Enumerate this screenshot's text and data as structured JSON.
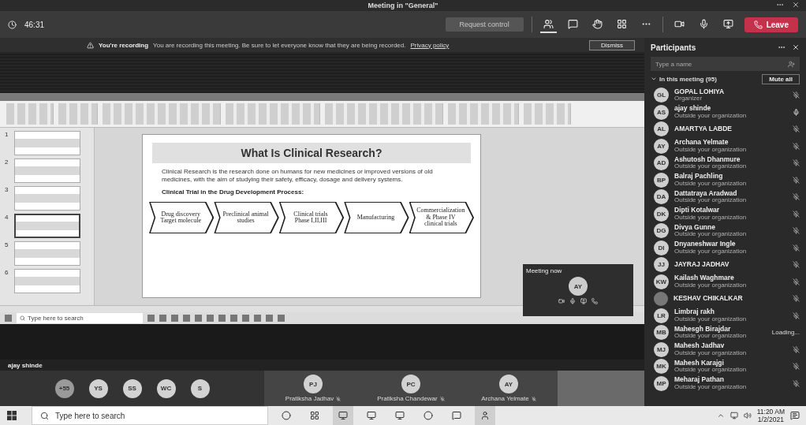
{
  "window": {
    "title": "Meeting in \"General\""
  },
  "toolbar": {
    "timer": "46:31",
    "request_control": {
      "label": "Request control",
      "disabled": true
    },
    "icons": [
      {
        "kind": "people",
        "selected": true
      },
      {
        "kind": "chat",
        "selected": false
      },
      {
        "kind": "hand",
        "selected": false
      },
      {
        "kind": "rooms",
        "selected": false
      },
      {
        "kind": "more",
        "selected": false
      },
      {
        "kind": "camera",
        "selected": false
      },
      {
        "kind": "mic",
        "selected": false
      },
      {
        "kind": "share",
        "selected": false
      }
    ],
    "leave": "Leave"
  },
  "banner": {
    "title": "You're recording",
    "message": "You are recording this meeting. Be sure to let everyone know that they are being recorded.",
    "link": "Privacy policy",
    "button": "Dismiss"
  },
  "shared_screen": {
    "thumbnails": [
      {
        "number": "1",
        "selected": false
      },
      {
        "number": "2",
        "selected": false
      },
      {
        "number": "3",
        "selected": false
      },
      {
        "number": "4",
        "selected": true
      },
      {
        "number": "5",
        "selected": false
      },
      {
        "number": "6",
        "selected": false
      }
    ],
    "slide": {
      "title": "What Is Clinical Research?",
      "body": "Clinical Research is the research done on humans for new medicines or improved versions of old medicines, with the aim of studying their safety, efficacy, dosage and delivery systems.",
      "subtitle": "Clinical Trial in the Drug Development Process:",
      "steps": [
        "Drug discovery Target molecule",
        "Preclinical animal studies",
        "Clinical trials Phase I,II,III",
        "Manufacturing",
        "Commercialization & Phase IV clinical trials"
      ]
    },
    "mini_window": {
      "title": "Meeting now",
      "initials": "AY"
    },
    "inner_taskbar": {
      "search_placeholder": "Type here to search"
    }
  },
  "presenter_label": "ajay shinde",
  "gallery": {
    "overflow": "+55",
    "avatars": [
      "YS",
      "SS",
      "WC",
      "S"
    ],
    "tiles": [
      {
        "initials": "PJ",
        "name": "Pratiksha Jadhav"
      },
      {
        "initials": "PC",
        "name": "Pratiksha Chandewar"
      },
      {
        "initials": "AY",
        "name": "Archana Yelmate"
      }
    ]
  },
  "participants": {
    "title": "Participants",
    "search_placeholder": "Type a name",
    "section": "In this meeting (95)",
    "expanded": true,
    "mute_all": "Mute all",
    "people": [
      {
        "initials": "GL",
        "name": "GOPAL LOHIYA",
        "subtitle": "Organizer",
        "kind": "muted"
      },
      {
        "initials": "AS",
        "name": "ajay shinde",
        "subtitle": "Outside your organization",
        "kind": "unmuted"
      },
      {
        "initials": "AL",
        "name": "AMARTYA LABDE",
        "kind": "muted"
      },
      {
        "initials": "AY",
        "name": "Archana Yelmate",
        "subtitle": "Outside your organization",
        "kind": "muted"
      },
      {
        "initials": "AD",
        "name": "Ashutosh Dhanmure",
        "subtitle": "Outside your organization",
        "kind": "muted"
      },
      {
        "initials": "BP",
        "name": "Balraj Pachling",
        "subtitle": "Outside your organization",
        "kind": "muted"
      },
      {
        "initials": "DA",
        "name": "Dattatraya Aradwad",
        "subtitle": "Outside your organization",
        "kind": "muted"
      },
      {
        "initials": "DK",
        "name": "Dipti Kotalwar",
        "subtitle": "Outside your organization",
        "kind": "muted"
      },
      {
        "initials": "DG",
        "name": "Divya Gunne",
        "subtitle": "Outside your organization",
        "kind": "muted"
      },
      {
        "initials": "DI",
        "name": "Dnyaneshwar Ingle",
        "subtitle": "Outside your organization",
        "kind": "muted"
      },
      {
        "initials": "JJ",
        "name": "JAYRAJ JADHAV",
        "kind": "muted"
      },
      {
        "initials": "KW",
        "name": "Kailash Waghmare",
        "subtitle": "Outside your organization",
        "kind": "muted"
      },
      {
        "name": "KESHAV CHIKALKAR",
        "kind": "muted"
      },
      {
        "initials": "LR",
        "name": "Limbraj rakh",
        "subtitle": "Outside your organization",
        "kind": "muted"
      },
      {
        "initials": "MB",
        "name": "Mahesgh Birajdar",
        "subtitle": "Outside your organization",
        "kind": "loading",
        "status_text": "Loading..."
      },
      {
        "initials": "MJ",
        "name": "Mahesh Jadhav",
        "subtitle": "Outside your organization",
        "kind": "muted"
      },
      {
        "initials": "MK",
        "name": "Mahesh Karajgi",
        "subtitle": "Outside your organization",
        "kind": "muted"
      },
      {
        "initials": "MP",
        "name": "Meharaj Pathan",
        "subtitle": "Outside your organization",
        "kind": "muted"
      }
    ]
  },
  "taskbar": {
    "search_placeholder": "Type here to search",
    "time": "11:20 AM",
    "date": "1/2/2021"
  }
}
